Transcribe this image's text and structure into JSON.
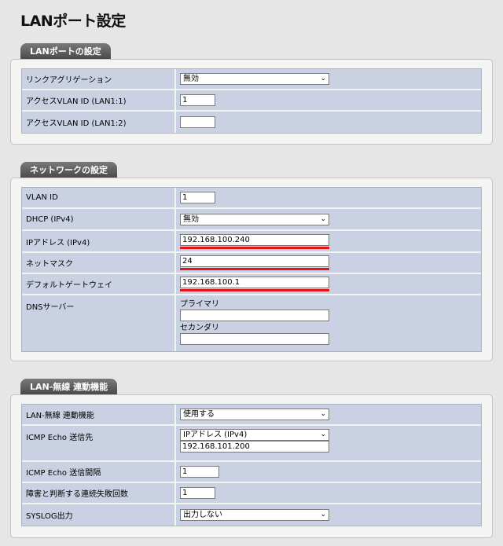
{
  "page": {
    "title": "LANポート設定"
  },
  "lan_port": {
    "section_title": "LANポートの設定",
    "link_agg_label": "リンクアグリゲーション",
    "link_agg_value": "無効",
    "vlan1_label": "アクセスVLAN ID (LAN1:1)",
    "vlan1_value": "1",
    "vlan2_label": "アクセスVLAN ID (LAN1:2)",
    "vlan2_value": ""
  },
  "network": {
    "section_title": "ネットワークの設定",
    "vlan_id_label": "VLAN ID",
    "vlan_id_value": "1",
    "dhcp_label": "DHCP (IPv4)",
    "dhcp_value": "無効",
    "ip_label": "IPアドレス (IPv4)",
    "ip_value": "192.168.100.240",
    "mask_label": "ネットマスク",
    "mask_value": "24",
    "gw_label": "デフォルトゲートウェイ",
    "gw_value": "192.168.100.1",
    "dns_label": "DNSサーバー",
    "dns_primary_label": "プライマリ",
    "dns_primary_value": "",
    "dns_secondary_label": "セカンダリ",
    "dns_secondary_value": ""
  },
  "lan_wireless": {
    "section_title": "LAN-無線 連動機能",
    "func_label": "LAN-無線 連動機能",
    "func_value": "使用する",
    "icmp_dest_label": "ICMP Echo 送信先",
    "icmp_dest_type": "IPアドレス (IPv4)",
    "icmp_dest_value": "192.168.101.200",
    "icmp_interval_label": "ICMP Echo 送信間隔",
    "icmp_interval_value": "1",
    "fail_count_label": "障害と判断する連続失敗回数",
    "fail_count_value": "1",
    "syslog_label": "SYSLOG出力",
    "syslog_value": "出力しない"
  },
  "colors": {
    "highlight": "#e8141a",
    "row_bg": "#c9d1e2",
    "tab_bg": "#555555"
  },
  "icons": {
    "dropdown": "chevron-down-icon"
  }
}
